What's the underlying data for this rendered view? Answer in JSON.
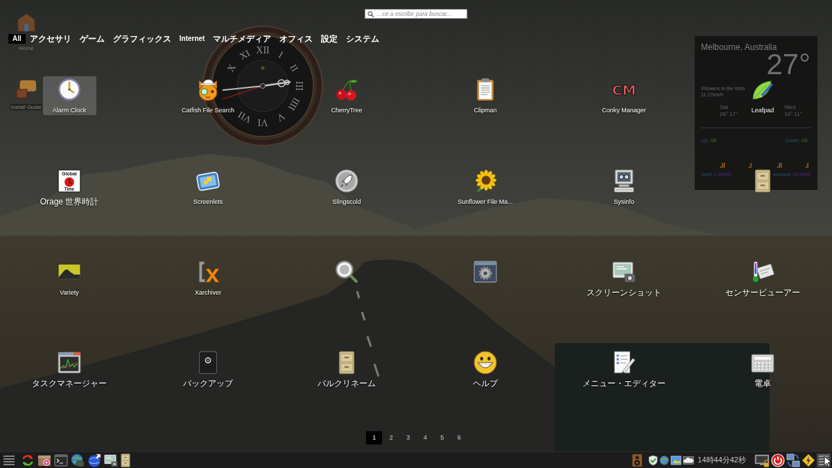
{
  "search": {
    "placeholder": "…ce a escribir para buscar..."
  },
  "categories": [
    {
      "label": "All",
      "selected": true
    },
    {
      "label": "アクセサリ",
      "selected": false
    },
    {
      "label": "ゲーム",
      "selected": false
    },
    {
      "label": "グラフィックス",
      "selected": false
    },
    {
      "label": "Internet",
      "selected": false
    },
    {
      "label": "マルチメディア",
      "selected": false
    },
    {
      "label": "オフィス",
      "selected": false
    },
    {
      "label": "設定",
      "selected": false
    },
    {
      "label": "システム",
      "selected": false
    }
  ],
  "desktop_icons": [
    {
      "label": "Home"
    },
    {
      "label": "Install Guide"
    }
  ],
  "clock_widget": {
    "numerals": {
      "h12": "XII",
      "h1": "I",
      "h2": "II",
      "h3": "III",
      "h4": "IIII",
      "h5": "V",
      "h6": "VI",
      "h7": "VII",
      "h10": "X",
      "h11": "XI"
    }
  },
  "weather_widget": {
    "location": "Melbourne, Australia",
    "temperature": "27°",
    "condition": "Showers in the Vicin",
    "wind": "11.27km/h",
    "forecast": [
      {
        "day": "Sat",
        "temps": "26° 17°"
      },
      {
        "day": "Wed",
        "temps": "19° 11°"
      }
    ],
    "upload": {
      "label": "Up:",
      "value": "0B"
    },
    "download": {
      "label": "Down:",
      "value": "0B"
    },
    "sent": {
      "label": "Sent:",
      "value": "1.89MiB"
    },
    "received": {
      "label": "eceived:",
      "value": "45.8MiB"
    }
  },
  "apps": [
    {
      "label": "Alarm Clock",
      "selected": true
    },
    {
      "label": "Catfish File Search",
      "selected": false
    },
    {
      "label": "CherryTree",
      "selected": false
    },
    {
      "label": "Clipman",
      "selected": false
    },
    {
      "label": "Conky Manager",
      "icon_text": [
        "CM"
      ],
      "selected": false
    },
    {
      "label": "Leafpad",
      "selected": false
    },
    {
      "label": "Orage 世界時計",
      "icon_text": [
        "Global",
        "Time"
      ],
      "selected": false
    },
    {
      "label": "Screenlets",
      "selected": false
    },
    {
      "label": "Slingscold",
      "selected": false
    },
    {
      "label": "Sunflower File Ma...",
      "selected": false
    },
    {
      "label": "Sysinfo",
      "selected": false
    },
    {
      "selected": false
    },
    {
      "label": "Variety",
      "selected": false
    },
    {
      "label": "Xarchiver",
      "selected": false
    },
    {
      "selected": false
    },
    {
      "selected": false
    },
    {
      "label": "スクリーンショット",
      "selected": false
    },
    {
      "label": "センサービューアー",
      "selected": false
    },
    {
      "label": "タスクマネージャー",
      "selected": false
    },
    {
      "label": "バックアップ",
      "selected": false
    },
    {
      "label": "バルクリネーム",
      "selected": false
    },
    {
      "label": "ヘルプ",
      "selected": false
    },
    {
      "label": "メニュー・エディター",
      "selected": false
    },
    {
      "label": "電卓",
      "selected": false
    }
  ],
  "pages": [
    {
      "label": "1",
      "selected": true
    },
    {
      "label": "2",
      "selected": false
    },
    {
      "label": "3",
      "selected": false
    },
    {
      "label": "4",
      "selected": false
    },
    {
      "label": "5",
      "selected": false
    },
    {
      "label": "6",
      "selected": false
    }
  ],
  "taskbar": {
    "clock": "14時44分42秒"
  }
}
